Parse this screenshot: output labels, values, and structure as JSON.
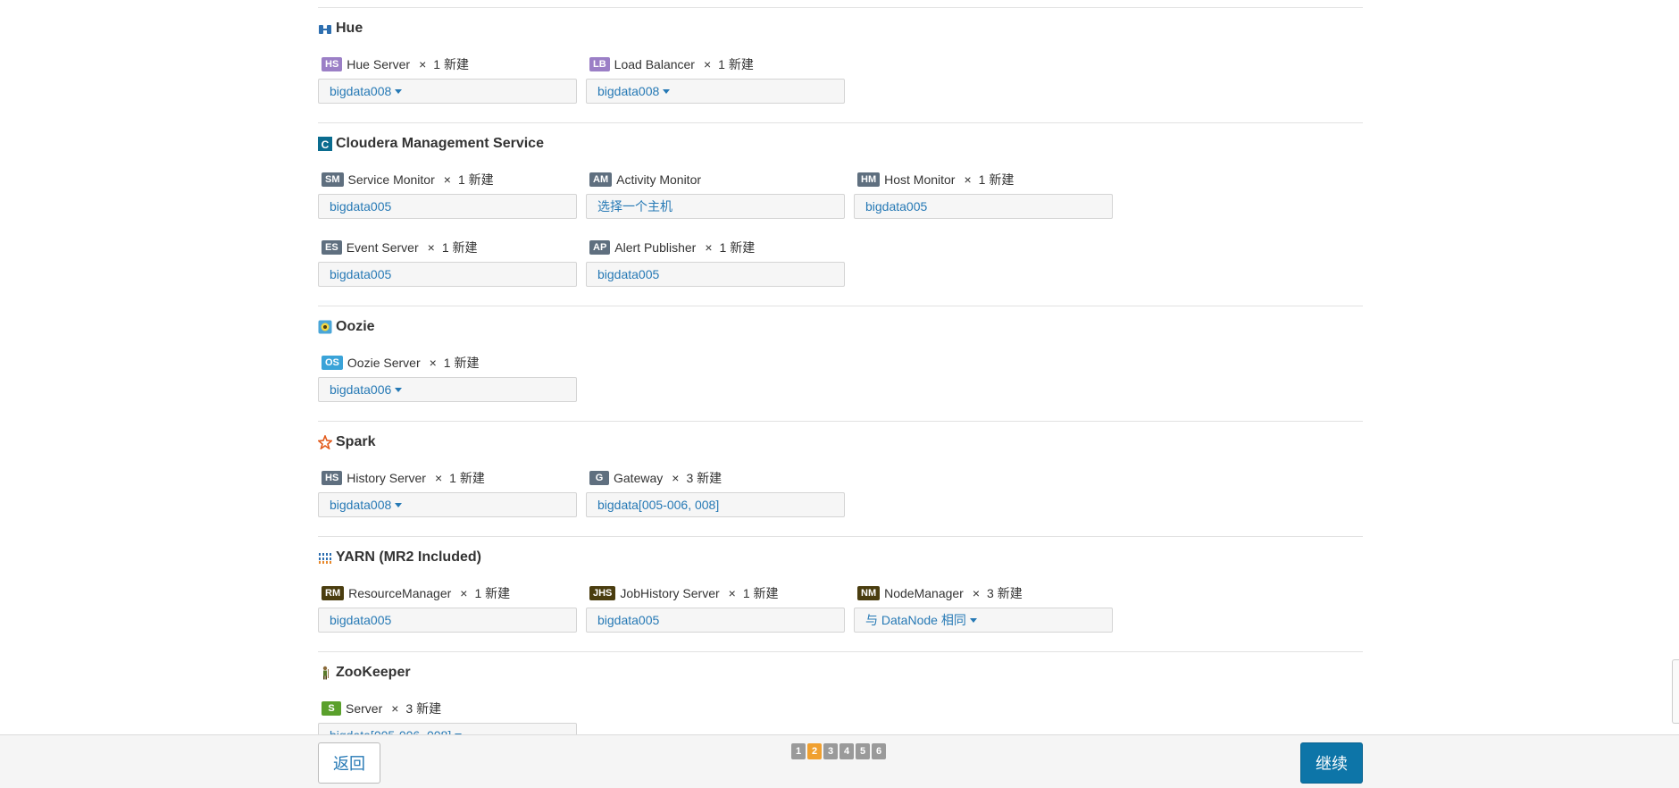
{
  "sections": [
    {
      "title": "Hue",
      "icon": "hue-icon",
      "roles": [
        {
          "badge": "HS",
          "color": "#9b7fc6",
          "name": "Hue Server",
          "times": "×",
          "new": "1 新建",
          "host": "bigdata008",
          "dropdown": true
        },
        {
          "badge": "LB",
          "color": "#9b7fc6",
          "name": "Load Balancer",
          "times": "×",
          "new": "1 新建",
          "host": "bigdata008",
          "dropdown": true
        }
      ]
    },
    {
      "title": "Cloudera Management Service",
      "icon": "cloudera-icon",
      "roles": [
        {
          "badge": "SM",
          "color": "#5f6f7f",
          "name": "Service Monitor",
          "times": "×",
          "new": "1 新建",
          "host": "bigdata005",
          "dropdown": false
        },
        {
          "badge": "AM",
          "color": "#5f6f7f",
          "name": "Activity Monitor",
          "times": "",
          "new": "",
          "host": "选择一个主机",
          "dropdown": false
        },
        {
          "badge": "HM",
          "color": "#5f6f7f",
          "name": "Host Monitor",
          "times": "×",
          "new": "1 新建",
          "host": "bigdata005",
          "dropdown": false
        },
        {
          "badge": "ES",
          "color": "#5f6f7f",
          "name": "Event Server",
          "times": "×",
          "new": "1 新建",
          "host": "bigdata005",
          "dropdown": false
        },
        {
          "badge": "AP",
          "color": "#5f6f7f",
          "name": "Alert Publisher",
          "times": "×",
          "new": "1 新建",
          "host": "bigdata005",
          "dropdown": false
        }
      ]
    },
    {
      "title": "Oozie",
      "icon": "oozie-icon",
      "roles": [
        {
          "badge": "OS",
          "color": "#3aa3d8",
          "name": "Oozie Server",
          "times": "×",
          "new": "1 新建",
          "host": "bigdata006",
          "dropdown": true
        }
      ]
    },
    {
      "title": "Spark",
      "icon": "spark-icon",
      "roles": [
        {
          "badge": "HS",
          "color": "#5f6f7f",
          "name": "History Server",
          "times": "×",
          "new": "1 新建",
          "host": "bigdata008",
          "dropdown": true
        },
        {
          "badge": "G",
          "color": "#5f6f7f",
          "name": "Gateway",
          "times": "×",
          "new": "3 新建",
          "host": "bigdata[005-006, 008]",
          "dropdown": false
        }
      ]
    },
    {
      "title": "YARN (MR2 Included)",
      "icon": "yarn-icon",
      "roles": [
        {
          "badge": "RM",
          "color": "#4a3d0f",
          "name": "ResourceManager",
          "times": "×",
          "new": "1 新建",
          "host": "bigdata005",
          "dropdown": false
        },
        {
          "badge": "JHS",
          "color": "#4a3d0f",
          "name": "JobHistory Server",
          "times": "×",
          "new": "1 新建",
          "host": "bigdata005",
          "dropdown": false
        },
        {
          "badge": "NM",
          "color": "#4a3d0f",
          "name": "NodeManager",
          "times": "×",
          "new": "3 新建",
          "host": "与 DataNode 相同",
          "dropdown": true
        }
      ]
    },
    {
      "title": "ZooKeeper",
      "icon": "zookeeper-icon",
      "roles": [
        {
          "badge": "S",
          "color": "#5aa02c",
          "name": "Server",
          "times": "×",
          "new": "3 新建",
          "host": "bigdata[005-006, 008]",
          "dropdown": true
        }
      ]
    }
  ],
  "footer": {
    "back_label": "返回",
    "continue_label": "继续",
    "pages": [
      "1",
      "2",
      "3",
      "4",
      "5",
      "6"
    ],
    "active_page": "2"
  }
}
